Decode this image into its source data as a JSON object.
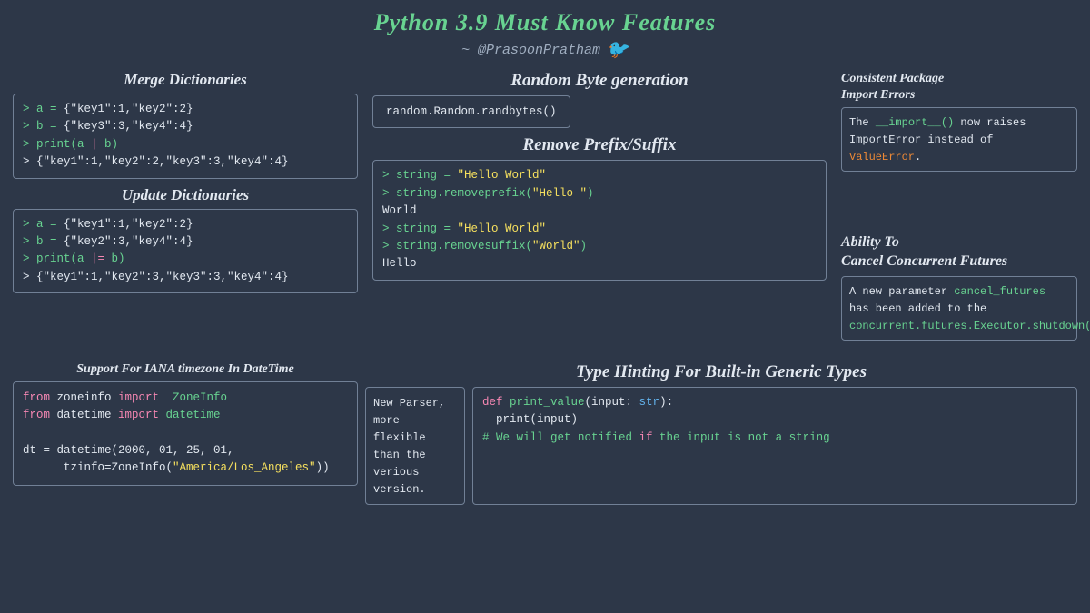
{
  "page": {
    "title": "Python 3.9 Must Know Features",
    "subtitle": "~ @PrasoonPratham",
    "twitter_icon": "🐦"
  },
  "merge_dict": {
    "title": "Merge Dictionaries",
    "lines": [
      "> a = {\"key1\":1,\"key2\":2}",
      "> b = {\"key3\":3,\"key4\":4}",
      "> print(a | b)",
      "> {\"key1\":1,\"key2\":2,\"key3\":3,\"key4\":4}"
    ]
  },
  "update_dict": {
    "title": "Update Dictionaries",
    "lines": [
      "> a = {\"key1\":1,\"key2\":2}",
      "> b = {\"key2\":3,\"key4\":4}",
      "> print(a |= b)",
      "> {\"key1\":1,\"key2\":3,\"key3\":3,\"key4\":4}"
    ]
  },
  "iana": {
    "title": "Support For IANA timezone In DateTime",
    "code": "from zoneinfo import  ZoneInfo\nfrom datetime import datetime\n\ndt = datetime(2000, 01, 25, 01,\n      tzinfo=ZoneInfo(\"America/Los_Angeles\"))"
  },
  "random_byte": {
    "title": "Random Byte generation",
    "code": "random.Random.randbytes()"
  },
  "remove_prefix": {
    "title": "Remove Prefix/Suffix",
    "lines": [
      "> string = \"Hello World\"",
      "> string.removeprefix(\"Hello \")",
      "World",
      "> string = \"Hello World\"",
      "> string.removesuffix(\"World\")",
      "Hello"
    ]
  },
  "consistent_package": {
    "title": "Consistent Package\nImport Errors",
    "prose": "The __import__() now raises\nImportError instead of ValueError."
  },
  "cancel_futures": {
    "title": "Ability To\nCancel Concurrent Futures",
    "prose": "A new parameter cancel_futures\nhas been added to the\nconcurrent.futures.Executor.shutdown()."
  },
  "type_hint": {
    "title": "Type Hinting For Built-in Generic Types",
    "new_parser": "New Parser,\nmore flexible\nthan the\nverious version.",
    "code": "def print_value(input: str):\n  print(input)\n# We will get notified if the input is not a string"
  }
}
